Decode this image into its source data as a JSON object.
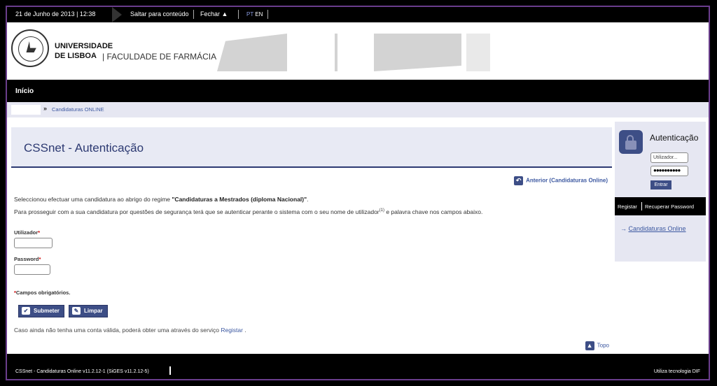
{
  "topbar": {
    "datetime": "21 de Junho de 2013 | 12:38",
    "skip_link": "Saltar para conteúdo",
    "close_link": "Fechar",
    "lang_pt": "PT",
    "lang_en": "EN"
  },
  "header": {
    "university_line1": "UNIVERSIDADE",
    "university_line2": "DE LISBOA",
    "faculty": "| FACULDADE DE FARMÁCIA"
  },
  "nav": {
    "home": "Início"
  },
  "breadcrumb": {
    "arrow": "»",
    "item": "Candidaturas ONLINE"
  },
  "main": {
    "title": "CSSnet - Autenticação",
    "previous_link": "Anterior (Candidaturas Online)",
    "para1_prefix": "Seleccionou efectuar uma candidatura ao abrigo do regime ",
    "para1_regime": "\"Candidaturas a Mestrados (diploma Nacional)\"",
    "para1_suffix": ".",
    "para2_prefix": "Para prosseguir com a sua candidatura por questões de segurança terá que se autenticar perante o sistema com o seu nome de utilizador",
    "para2_sup": "(1)",
    "para2_suffix": " e palavra chave nos campos abaixo.",
    "user_label": "Utilizador",
    "password_label": "Password",
    "required_mark": "*",
    "required_note": "Campos obrigatórios.",
    "submit_button": "Submeter",
    "clear_button": "Limpar",
    "no_account_prefix": "Caso ainda não tenha uma conta válida, poderá obter uma através do serviço ",
    "register_link": "Registar",
    "no_account_suffix": " .",
    "top_link": "Topo"
  },
  "sidebar": {
    "title": "Autenticação",
    "user_value": "Utilizador...",
    "password_value": "●●●●●●●●●●",
    "login_button": "Entrar",
    "register_link": "Registar",
    "recover_link": "Recuperar Password",
    "applications_link": "Candidaturas Online"
  },
  "footer": {
    "version": "CSSnet - Candidaturas Online v11.2.12-1 (SiGES v11.2.12-5)",
    "technology": "Utiliza tecnologia DIF"
  }
}
